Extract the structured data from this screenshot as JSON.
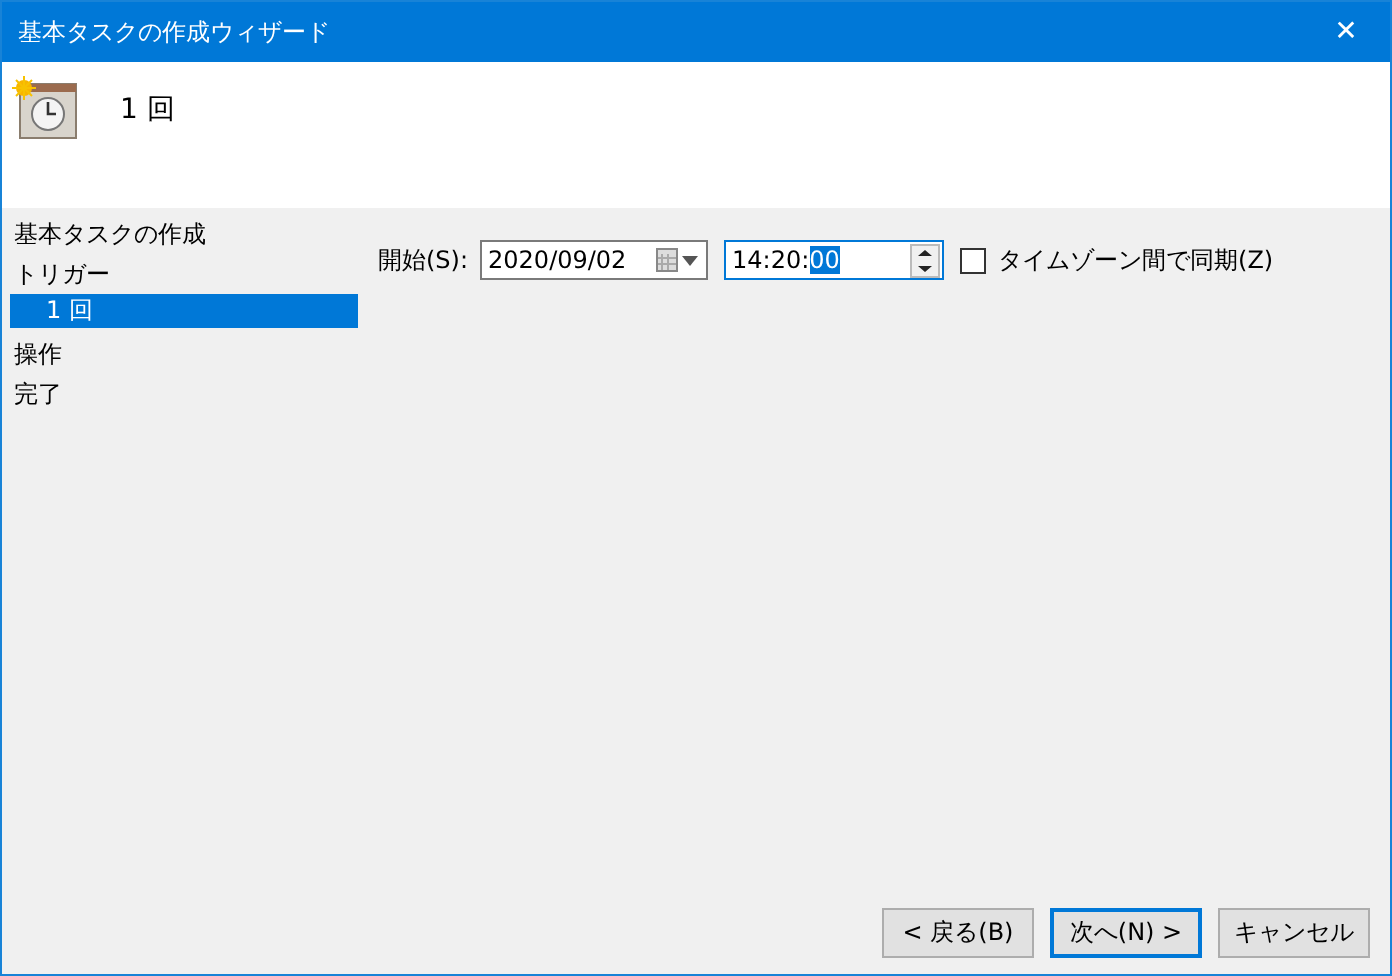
{
  "window": {
    "title": "基本タスクの作成ウィザード",
    "close": "✕"
  },
  "header": {
    "title": "1 回"
  },
  "sidebar": {
    "items": [
      {
        "label": "基本タスクの作成",
        "selected": false
      },
      {
        "label": "トリガー",
        "selected": false,
        "children": [
          {
            "label": "1 回",
            "selected": true
          }
        ]
      },
      {
        "label": "操作",
        "selected": false
      },
      {
        "label": "完了",
        "selected": false
      }
    ]
  },
  "start": {
    "label": "開始(S):",
    "date": "2020/09/02",
    "time": "14:20:",
    "time_selected": "00"
  },
  "sync_timezone": {
    "label": "タイムゾーン間で同期(Z)",
    "checked": false
  },
  "buttons": [
    {
      "label": "< 戻る(B)",
      "default": false
    },
    {
      "label": "次へ(N) >",
      "default": true
    },
    {
      "label": "キャンセル",
      "default": false
    }
  ]
}
